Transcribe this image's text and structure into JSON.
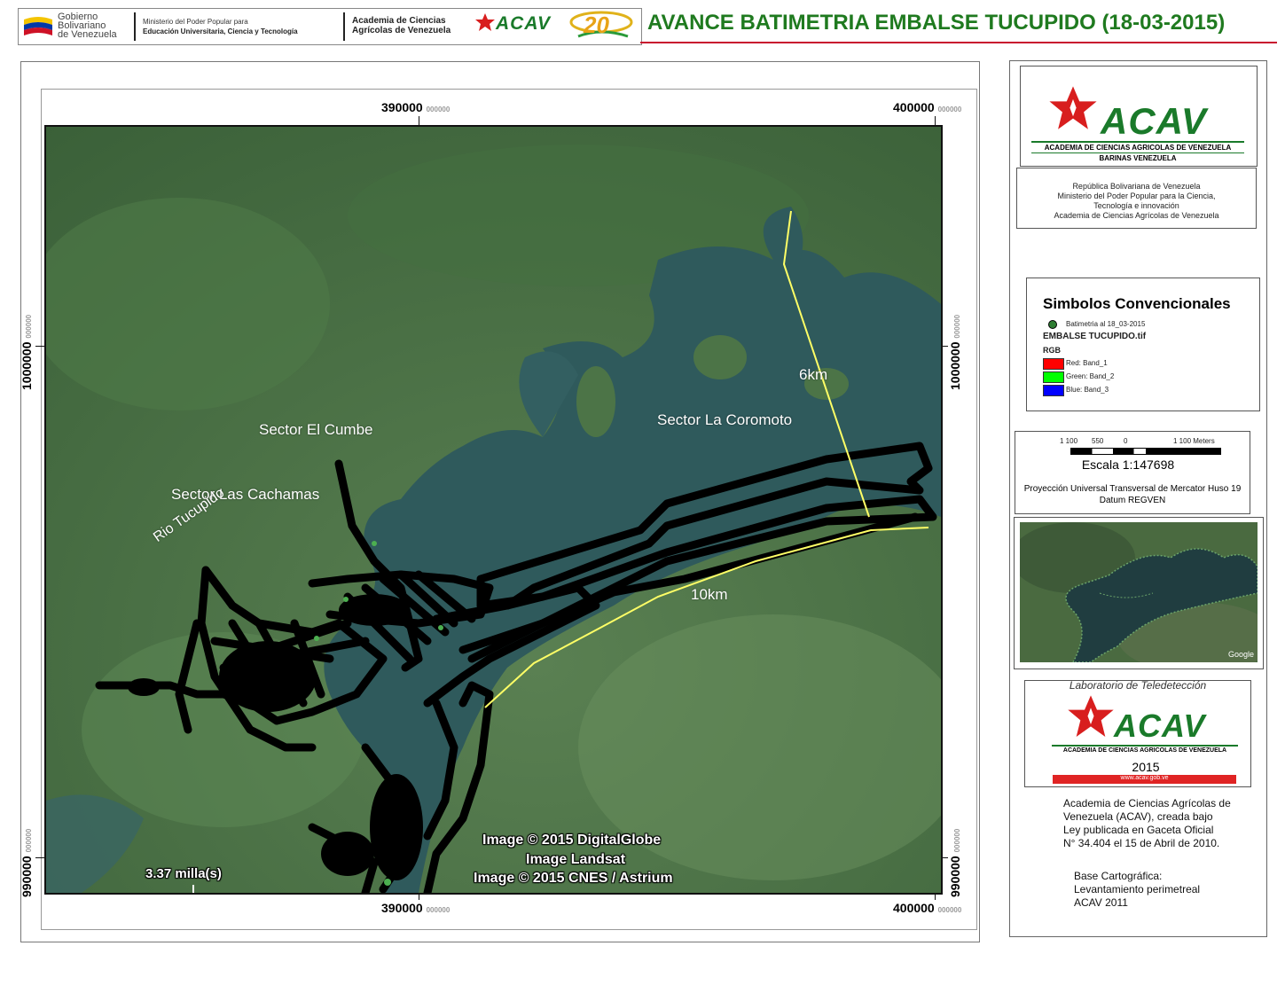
{
  "header": {
    "gov_line1": "Gobierno",
    "gov_line2": "Bolivariano",
    "gov_line3": "de Venezuela",
    "ministry_line1": "Ministerio del Poder Popular para",
    "ministry_line2": "Educación Universitaria, Ciencia y Tecnología",
    "academy_line1": "Academia de Ciencias",
    "academy_line2": "Agrícolas de Venezuela",
    "acav_logo_text": "ACAV",
    "anniversary_text": "20",
    "title": "AVANCE BATIMETRIA EMBALSE TUCUPIDO (18-03-2015)",
    "title_color": "#1f7a1f",
    "rule_color": "#c8102e"
  },
  "map": {
    "x_ticks": [
      {
        "label": "390000",
        "sub": "000000"
      },
      {
        "label": "400000",
        "sub": "000000"
      }
    ],
    "y_ticks": [
      {
        "label": "1000000",
        "sub": "000000"
      },
      {
        "label": "990000",
        "sub": "000000"
      }
    ],
    "labels": {
      "sector_el_cumbe": "Sector El Cumbe",
      "sector_las_cachamas": "Sector Las Cachamas",
      "rio_tucupido": "Rio Tucupido",
      "sector_la_coromoto": "Sector La Coromoto",
      "dist_6km": "6km",
      "dist_10km": "10km"
    },
    "credits": {
      "line1": "Image © 2015 DigitalGlobe",
      "line2": "Image Landsat",
      "line3": "Image © 2015 CNES / Astrium"
    },
    "scale_label": "3.37 milla(s)",
    "colors": {
      "forest": "#3e6b3e",
      "water": "#2f5a5c",
      "track": "#000000",
      "distance_line": "#ffff66"
    }
  },
  "panel": {
    "acav_logo_text": "ACAV",
    "acav_subtitle": "ACADEMIA DE CIENCIAS AGRICOLAS DE VENEZUELA",
    "acav_location": "BARINAS VENEZUELA",
    "institution_lines": [
      "República Bolivariana de Venezuela",
      "Ministerio del Poder Popular para  la Ciencia,",
      "Tecnología  e innovación",
      "Academia de Ciencias Agrícolas de  Venezuela"
    ],
    "legend": {
      "title": "Simbolos Convencionales",
      "point_label": "Batimetria al 18_03-2015",
      "raster_label": "EMBALSE TUCUPIDO.tif",
      "rgb_label": "RGB",
      "bands": [
        {
          "label": "Red:    Band_1",
          "color": "#ff0000"
        },
        {
          "label": "Green: Band_2",
          "color": "#00ff00"
        },
        {
          "label": "Blue:   Band_3",
          "color": "#0000ff"
        }
      ]
    },
    "scale": {
      "ticks": [
        "1 100",
        "550",
        "0",
        "1 100 Meters"
      ],
      "ratio": "Escala 1:147698",
      "projection_line1": "Proyección Universal Transversal de Mercator Huso 19",
      "projection_line2": "Datum REGVEN"
    },
    "overview_credit": "Google",
    "lab": {
      "title": "Laboratorio de Teledetección",
      "logo_text": "ACAV",
      "subtitle": "ACADEMIA DE CIENCIAS AGRICOLAS DE VENEZUELA",
      "year": "2015",
      "website": "www.acav.gob.ve"
    },
    "note_lines": [
      "Academia de Ciencias Agrícolas de",
      "Venezuela (ACAV), creada bajo",
      "Ley publicada en Gaceta Oficial",
      "N° 34.404 el 15 de Abril de 2010."
    ],
    "base_lines": [
      "Base Cartográfica:",
      "Levantamiento perimetreal",
      "ACAV 2011"
    ]
  }
}
